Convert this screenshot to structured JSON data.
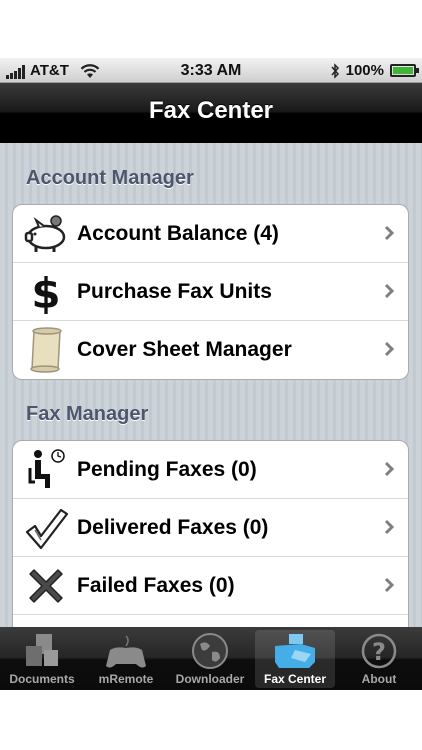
{
  "status_bar": {
    "carrier": "AT&T",
    "time": "3:33 AM",
    "battery": "100%",
    "battery_level": 1.0
  },
  "nav": {
    "title": "Fax Center"
  },
  "sections": [
    {
      "header": "Account Manager",
      "rows": [
        {
          "label": "Account Balance (4)",
          "icon": "piggy-bank-icon"
        },
        {
          "label": "Purchase Fax Units",
          "icon": "dollar-sign-icon"
        },
        {
          "label": "Cover Sheet Manager",
          "icon": "scroll-icon"
        }
      ]
    },
    {
      "header": "Fax Manager",
      "rows": [
        {
          "label": "Pending Faxes (0)",
          "icon": "waiting-person-icon"
        },
        {
          "label": "Delivered Faxes (0)",
          "icon": "checkmark-icon"
        },
        {
          "label": "Failed Faxes (0)",
          "icon": "x-mark-icon"
        }
      ]
    }
  ],
  "tabs": [
    {
      "label": "Documents",
      "icon": "documents-icon"
    },
    {
      "label": "mRemote",
      "icon": "gamepad-icon"
    },
    {
      "label": "Downloader",
      "icon": "globe-icon"
    },
    {
      "label": "Fax Center",
      "icon": "fax-icon",
      "selected": true
    },
    {
      "label": "About",
      "icon": "question-icon"
    }
  ],
  "colors": {
    "nav_bg": "#000000",
    "section_header": "#4c566c",
    "content_bg": "#c5ccd4",
    "tab_selected_icon": "#45aee8"
  }
}
